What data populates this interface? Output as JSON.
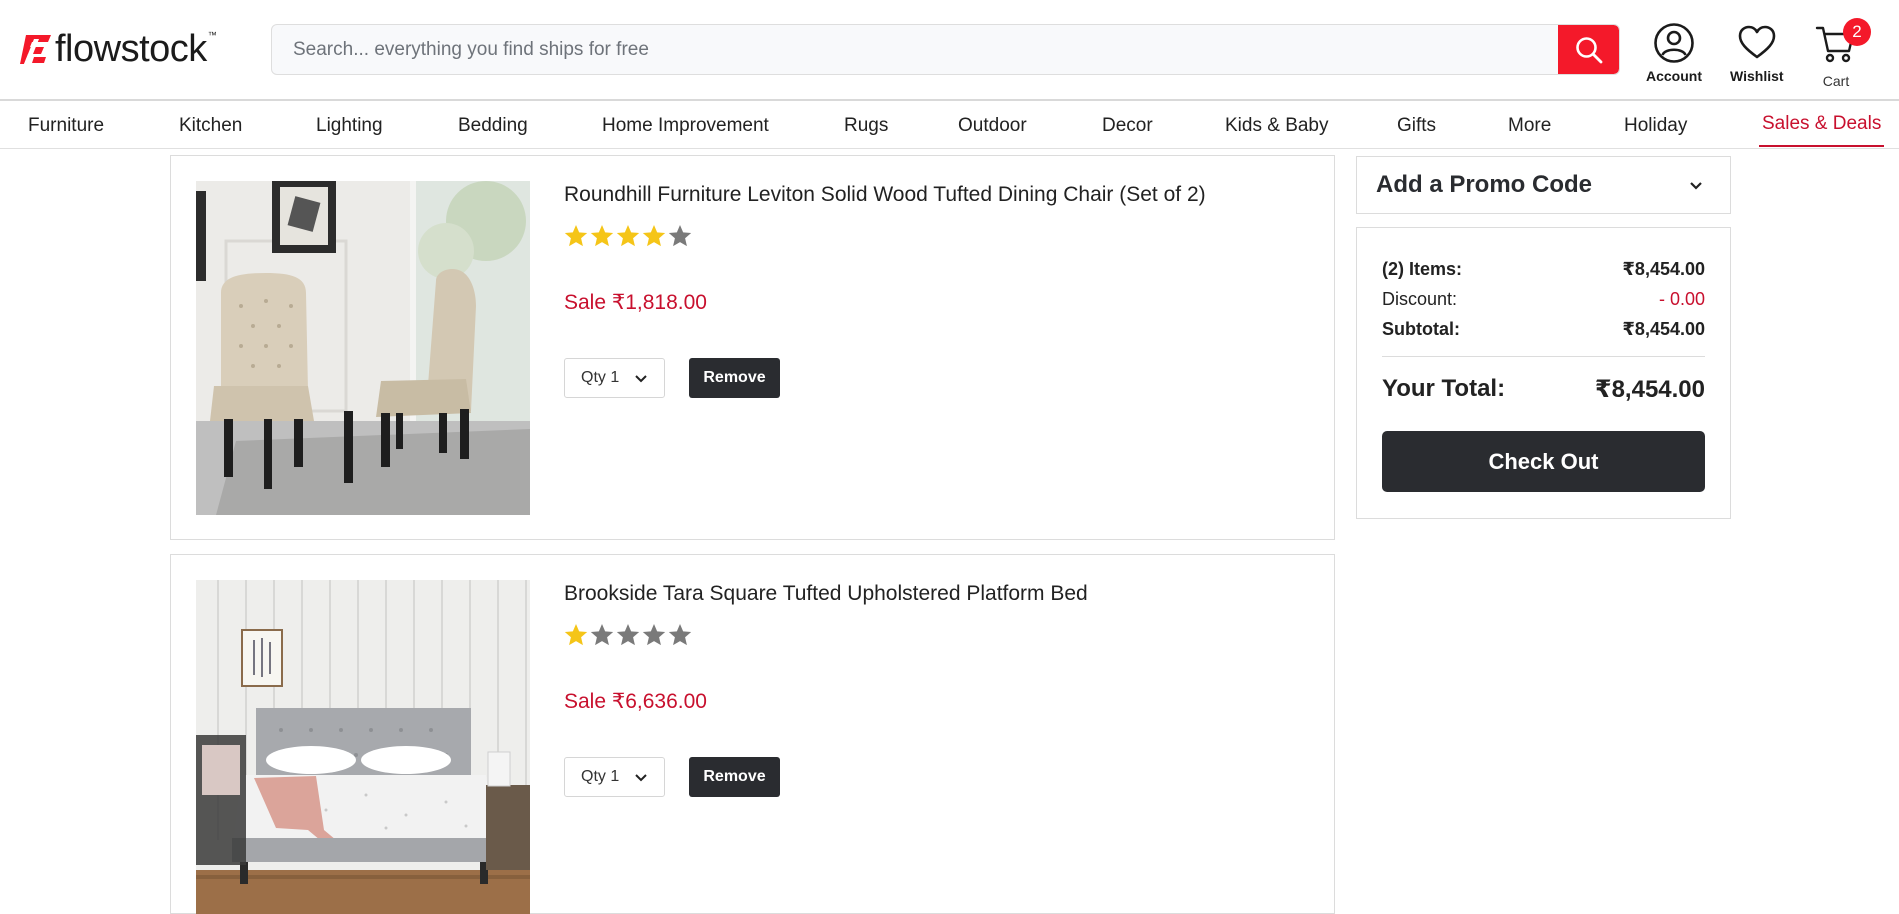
{
  "brand": {
    "name": "flowstock",
    "tm": "™",
    "accent": "#f4192a",
    "sale_color": "#c8102e",
    "dark_button": "#2a2c30"
  },
  "search": {
    "placeholder": "Search... everything you find ships for free",
    "value": ""
  },
  "header": {
    "account_label": "Account",
    "wishlist_label": "Wishlist",
    "cart_label": "Cart",
    "cart_count": "2"
  },
  "nav": {
    "items": [
      "Furniture",
      "Kitchen",
      "Lighting",
      "Bedding",
      "Home Improvement",
      "Rugs",
      "Outdoor",
      "Decor",
      "Kids & Baby",
      "Gifts",
      "More",
      "Holiday",
      "Sales & Deals"
    ]
  },
  "cart": {
    "items": [
      {
        "title": "Roundhill Furniture Leviton Solid Wood Tufted Dining Chair (Set of 2)",
        "rating": 4,
        "rating_max": 5,
        "price": "Sale ₹1,818.00",
        "qty": "Qty 1",
        "remove_label": "Remove",
        "image_icon": "dining-chairs-image"
      },
      {
        "title": "Brookside Tara Square Tufted Upholstered Platform Bed",
        "rating": 1,
        "rating_max": 5,
        "price": "Sale ₹6,636.00",
        "qty": "Qty 1",
        "remove_label": "Remove",
        "image_icon": "platform-bed-image"
      }
    ]
  },
  "summary": {
    "promo_label": "Add a Promo Code",
    "items_label": "(2) Items:",
    "items_value": "₹8,454.00",
    "discount_label": "Discount:",
    "discount_value": "- 0.00",
    "subtotal_label": "Subtotal:",
    "subtotal_value": "₹8,454.00",
    "total_label": "Your Total:",
    "total_value": "₹8,454.00",
    "checkout_label": "Check Out"
  }
}
